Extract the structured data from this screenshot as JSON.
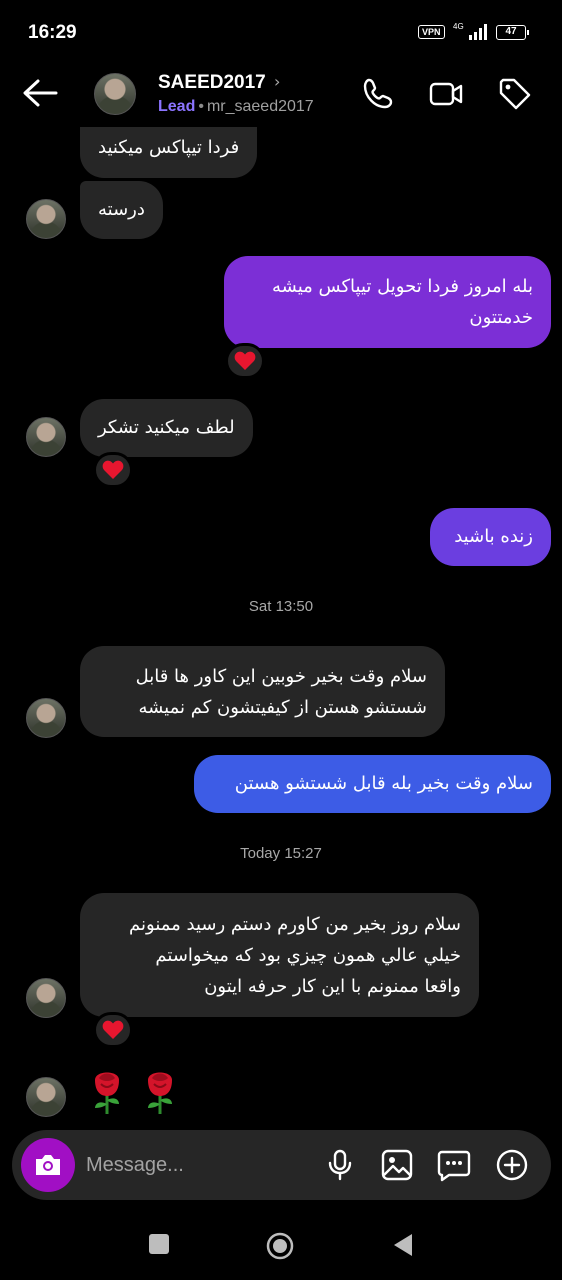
{
  "status_bar": {
    "time": "16:29",
    "vpn": "VPN",
    "network": "4G",
    "battery": "47"
  },
  "header": {
    "title": "SAEED2017",
    "chevron": "›",
    "lead_label": "Lead",
    "separator": "•",
    "handle": "mr_saeed2017",
    "icons": [
      "back-arrow-icon",
      "phone-icon",
      "video-camera-icon",
      "tag-icon"
    ]
  },
  "messages": [
    {
      "direction": "in",
      "text": "فردا  تیپاکس میکنید"
    },
    {
      "direction": "in",
      "text": "درسته"
    },
    {
      "direction": "out",
      "lines": [
        "بله امروز فردا تحویل تیپاکس میشه",
        "خدمتتون"
      ],
      "reaction": "❤️"
    },
    {
      "direction": "in",
      "text": "لطف میکنید تشکر",
      "reaction": "❤️"
    },
    {
      "direction": "out",
      "text": "زنده باشید"
    },
    {
      "direction": "in",
      "lines": [
        "سلام وقت بخیر خوبین این کاور ها قابل",
        "شستشو هستن از کیفیتشون کم نمیشه"
      ]
    },
    {
      "direction": "out",
      "text": "سلام وقت بخیر بله قابل شستشو هستن"
    },
    {
      "direction": "in",
      "lines": [
        "سلام روز بخير من كاورم دستم رسيد ممنونم",
        "خيلي عالي همون چيزي بود كه ميخواستم",
        "واقعا ممنونم با اين كار حرفه ايتون"
      ],
      "reaction": "❤️"
    },
    {
      "direction": "in",
      "type": "emoji",
      "items": [
        "rose-icon",
        "rose-icon"
      ]
    }
  ],
  "timestamps": {
    "first": "Sat 13:50",
    "second": "Today 15:27"
  },
  "composer": {
    "placeholder": "Message...",
    "icons": [
      "camera-icon",
      "microphone-icon",
      "gallery-icon",
      "sticker-chat-icon",
      "add-icon"
    ]
  },
  "colors": {
    "incoming_bubble": "#262626",
    "outgoing_purple": "#7c2fd6",
    "outgoing_violet": "#6b3ee0",
    "outgoing_blue": "#3d5ce6",
    "lead": "#8b74ff",
    "camera_button": "#a10fc4"
  }
}
